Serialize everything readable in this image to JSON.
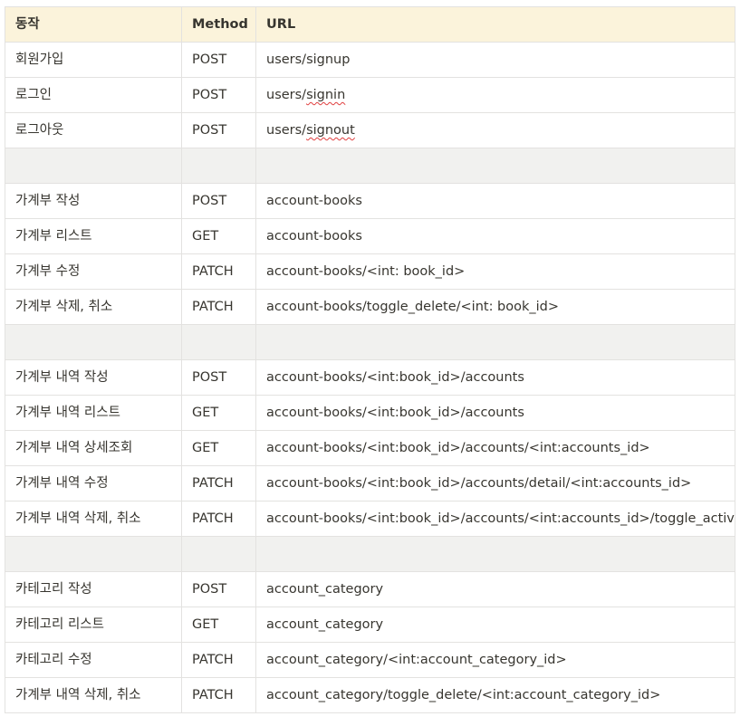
{
  "headers": {
    "action": "동작",
    "method": "Method",
    "url": "URL"
  },
  "rows": [
    {
      "action": "회원가입",
      "method": "POST",
      "url": "users/signup"
    },
    {
      "action": "로그인",
      "method": "POST",
      "url_prefix": "users/",
      "url_marked": "signin"
    },
    {
      "action": "로그아웃",
      "method": "POST",
      "url_prefix": "users/",
      "url_marked": "signout"
    },
    {
      "spacer": true
    },
    {
      "action": "가계부 작성",
      "method": "POST",
      "url": "account-books"
    },
    {
      "action": "가계부 리스트",
      "method": "GET",
      "url": "account-books"
    },
    {
      "action": "가계부 수정",
      "method": "PATCH",
      "url": "account-books/<int: book_id>"
    },
    {
      "action": "가계부 삭제, 취소",
      "method": "PATCH",
      "url": "account-books/toggle_delete/<int: book_id>"
    },
    {
      "spacer": true
    },
    {
      "action": "가계부 내역 작성",
      "method": "POST",
      "url": "account-books/<int:book_id>/accounts"
    },
    {
      "action": "가계부 내역 리스트",
      "method": "GET",
      "url": "account-books/<int:book_id>/accounts"
    },
    {
      "action": "가계부 내역 상세조회",
      "method": "GET",
      "url": "account-books/<int:book_id>/accounts/<int:accounts_id>"
    },
    {
      "action": "가계부 내역 수정",
      "method": "PATCH",
      "url": "account-books/<int:book_id>/accounts/detail/<int:accounts_id>"
    },
    {
      "action": "가계부 내역 삭제, 취소",
      "method": "PATCH",
      "url": "account-books/<int:book_id>/accounts/<int:accounts_id>/toggle_active"
    },
    {
      "spacer": true
    },
    {
      "action": "카테고리 작성",
      "method": "POST",
      "url": "account_category"
    },
    {
      "action": "카테고리 리스트",
      "method": "GET",
      "url": "account_category"
    },
    {
      "action": "카테고리 수정",
      "method": "PATCH",
      "url": "account_category/<int:account_category_id>"
    },
    {
      "action": "가계부 내역 삭제, 취소",
      "method": "PATCH",
      "url": "account_category/toggle_delete/<int:account_category_id>"
    }
  ]
}
